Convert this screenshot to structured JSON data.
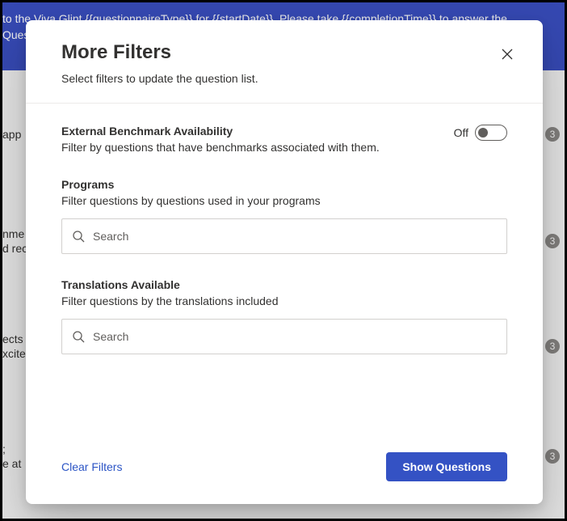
{
  "banner": {
    "text": "to the Viva Glint {{questionnaireType}} for {{startDate}}. Please take {{completionTime}} to answer the Questions — your answers will be heard while protecting your confidentiality. (From {{senderNam r taki"
  },
  "background": {
    "rows": [
      {
        "lines": [
          "app"
        ],
        "badge": "3"
      },
      {
        "lines": [
          "nme",
          "d rec"
        ],
        "badge": "3"
      },
      {
        "lines": [
          "ects",
          "xcite"
        ],
        "badge": "3"
      },
      {
        "lines": [
          ";",
          "e at"
        ],
        "badge": "3"
      }
    ]
  },
  "modal": {
    "title": "More Filters",
    "subtitle": "Select filters to update the question list.",
    "sections": {
      "benchmark": {
        "title": "External Benchmark Availability",
        "desc": "Filter by questions that have benchmarks associated with them.",
        "toggle_label": "Off"
      },
      "programs": {
        "title": "Programs",
        "desc": "Filter questions by questions used in your programs",
        "placeholder": "Search"
      },
      "translations": {
        "title": "Translations Available",
        "desc": "Filter questions by the translations included",
        "placeholder": "Search"
      }
    },
    "footer": {
      "clear": "Clear Filters",
      "show": "Show Questions"
    }
  }
}
